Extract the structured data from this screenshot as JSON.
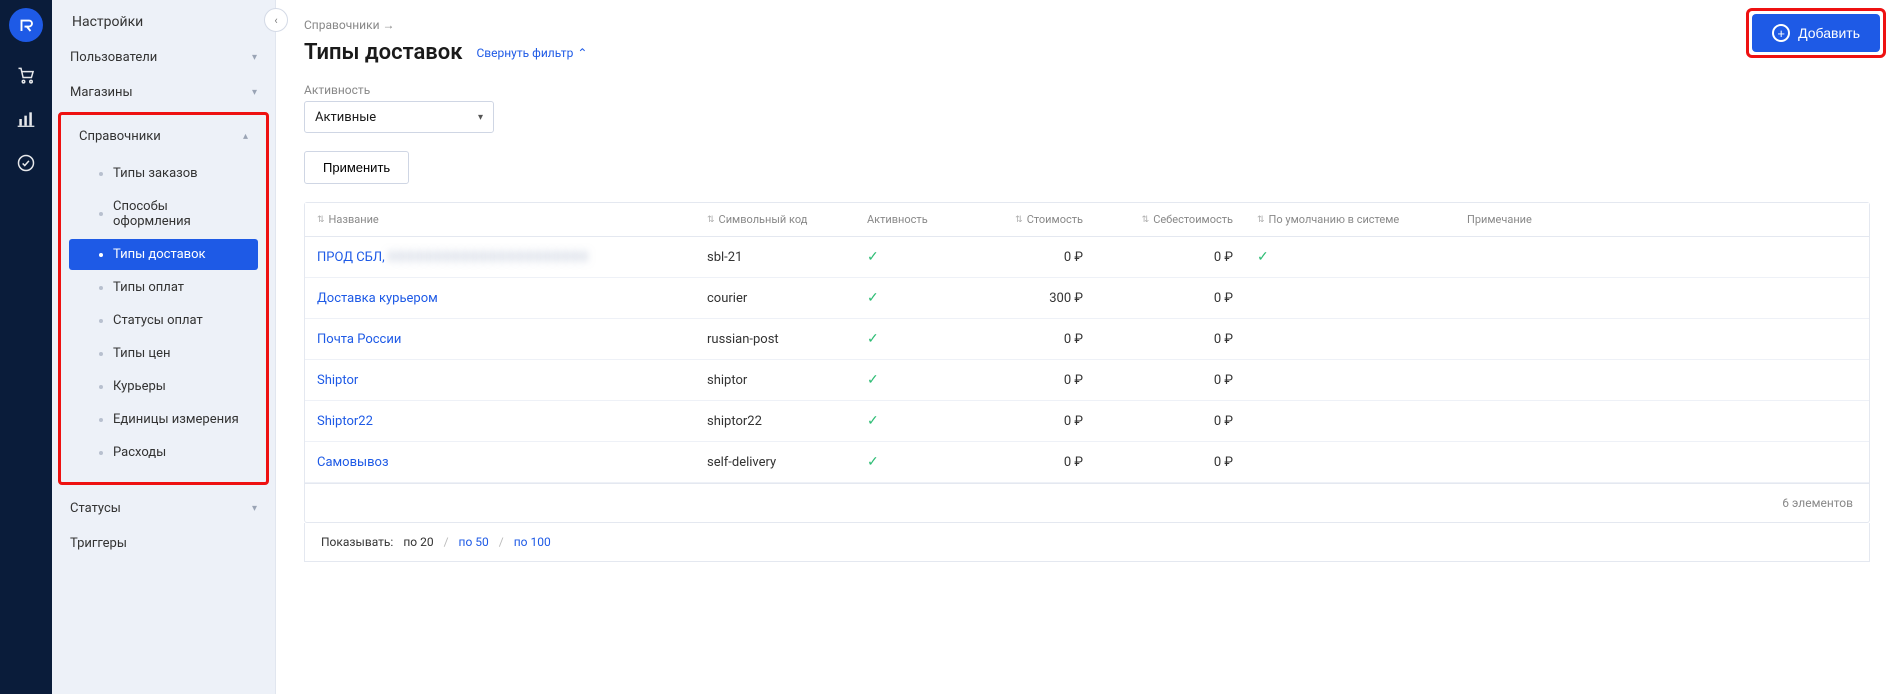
{
  "rail": {
    "logo_label": "retailCRM"
  },
  "sidebar": {
    "title": "Настройки",
    "items": [
      {
        "label": "Пользователи",
        "expanded": false
      },
      {
        "label": "Магазины",
        "expanded": false
      },
      {
        "label": "Справочники",
        "expanded": true
      },
      {
        "label": "Статусы",
        "expanded": false
      },
      {
        "label": "Триггеры",
        "expanded": false
      }
    ],
    "sub_items": [
      {
        "label": "Типы заказов"
      },
      {
        "label": "Способы оформления"
      },
      {
        "label": "Типы доставок"
      },
      {
        "label": "Типы оплат"
      },
      {
        "label": "Статусы оплат"
      },
      {
        "label": "Типы цен"
      },
      {
        "label": "Курьеры"
      },
      {
        "label": "Единицы измерения"
      },
      {
        "label": "Расходы"
      }
    ]
  },
  "breadcrumb": "Справочники →",
  "page_title": "Типы доставок",
  "filter_toggle": "Свернуть фильтр",
  "filter": {
    "label": "Активность",
    "value": "Активные"
  },
  "apply_label": "Применить",
  "add_label": "Добавить",
  "columns": {
    "name": "Название",
    "code": "Символьный код",
    "active": "Активность",
    "cost": "Стоимость",
    "self_cost": "Себестоимость",
    "default": "По умолчанию в системе",
    "note": "Примечание"
  },
  "rows": [
    {
      "name_prefix": "ПРОД СБЛ,",
      "name_blur": "XXXXXXXXXXXXXXXXXXXXXX",
      "code": "sbl-21",
      "active": true,
      "cost": "0 ₽",
      "self_cost": "0 ₽",
      "default": true,
      "note": ""
    },
    {
      "name": "Доставка курьером",
      "code": "courier",
      "active": true,
      "cost": "300 ₽",
      "self_cost": "0 ₽",
      "default": false,
      "note": ""
    },
    {
      "name": "Почта России",
      "code": "russian-post",
      "active": true,
      "cost": "0 ₽",
      "self_cost": "0 ₽",
      "default": false,
      "note": ""
    },
    {
      "name": "Shiptor",
      "code": "shiptor",
      "active": true,
      "cost": "0 ₽",
      "self_cost": "0 ₽",
      "default": false,
      "note": ""
    },
    {
      "name": "Shiptor22",
      "code": "shiptor22",
      "active": true,
      "cost": "0 ₽",
      "self_cost": "0 ₽",
      "default": false,
      "note": ""
    },
    {
      "name": "Самовывоз",
      "code": "self-delivery",
      "active": true,
      "cost": "0 ₽",
      "self_cost": "0 ₽",
      "default": false,
      "note": ""
    }
  ],
  "footer_count": "6 элементов",
  "pager": {
    "label": "Показывать:",
    "opt20": "по 20",
    "opt50": "по 50",
    "opt100": "по 100"
  }
}
